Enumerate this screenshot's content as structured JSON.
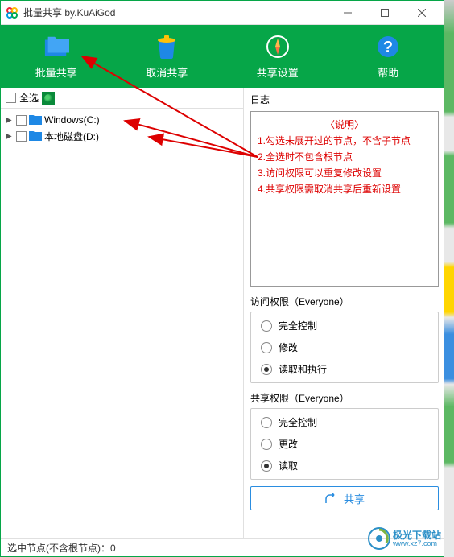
{
  "window": {
    "title": "批量共享 by.KuAiGod"
  },
  "toolbar": {
    "batch_share": "批量共享",
    "cancel_share": "取消共享",
    "share_settings": "共享设置",
    "help": "帮助"
  },
  "left": {
    "select_all": "全选",
    "tree": [
      {
        "label": "Windows(C:)"
      },
      {
        "label": "本地磁盘(D:)"
      }
    ]
  },
  "right": {
    "log_label": "日志",
    "log_title": "〈说明〉",
    "log_lines": [
      "1.勾选未展开过的节点，不含子节点",
      "2.全选时不包含根节点",
      "3.访问权限可以重复修改设置",
      "4.共享权限需取消共享后重新设置"
    ],
    "access_label": "访问权限（Everyone）",
    "access_options": [
      {
        "label": "完全控制",
        "selected": false
      },
      {
        "label": "修改",
        "selected": false
      },
      {
        "label": "读取和执行",
        "selected": true
      }
    ],
    "share_label": "共享权限（Everyone）",
    "share_options": [
      {
        "label": "完全控制",
        "selected": false
      },
      {
        "label": "更改",
        "selected": false
      },
      {
        "label": "读取",
        "selected": true
      }
    ],
    "share_btn": "共享"
  },
  "status": {
    "prefix": "选中节点(不含根节点)：",
    "count": "0"
  },
  "watermark": {
    "cn": "极光下载站",
    "en": "www.xz7.com"
  }
}
